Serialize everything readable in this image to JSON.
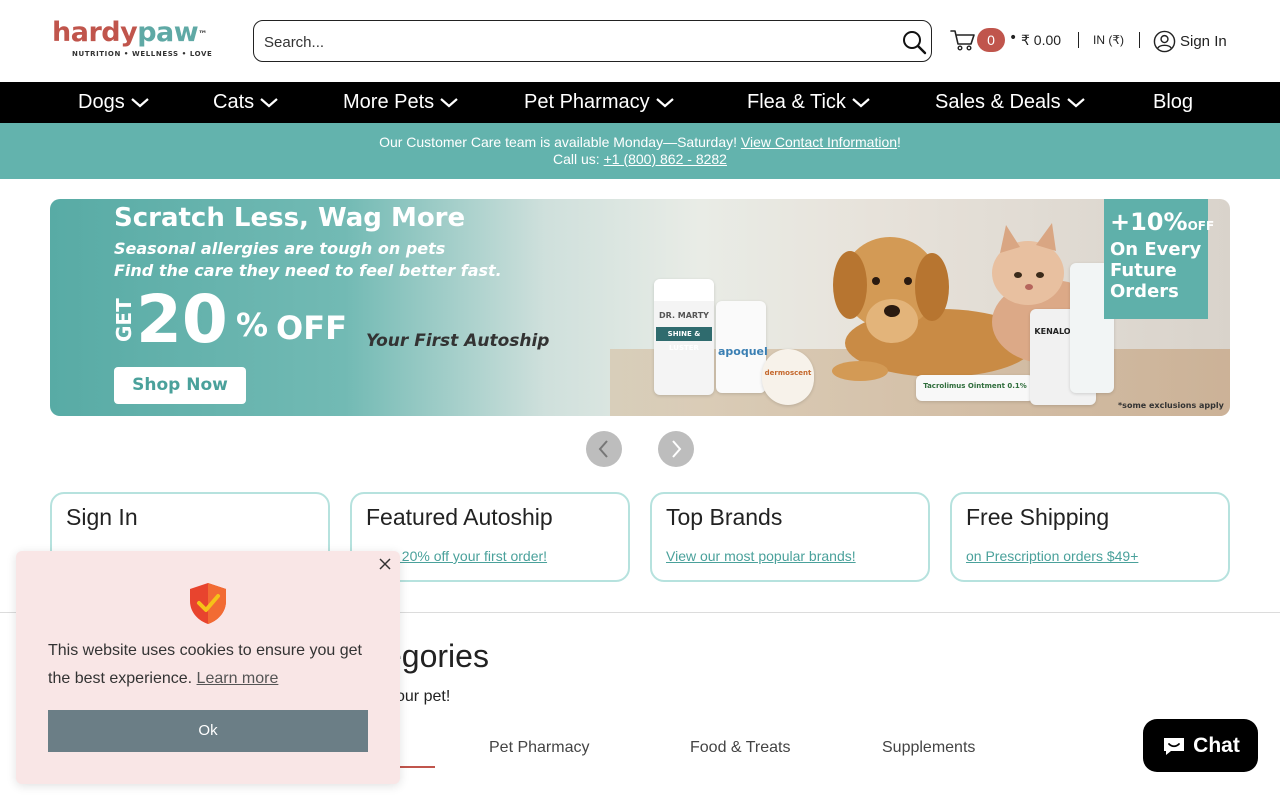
{
  "brand": {
    "logo_part1": "hardy",
    "logo_part2": "paw",
    "trademark": "™",
    "tagline": "NUTRITION  •  WELLNESS  •  LOVE"
  },
  "search": {
    "placeholder": "Search..."
  },
  "cart": {
    "count": "0",
    "separator": "•",
    "total": "₹ 0.00"
  },
  "locale": "IN (₹)",
  "account": {
    "signin_label": "Sign In"
  },
  "nav": {
    "items": [
      {
        "label": "Dogs",
        "has_dropdown": true
      },
      {
        "label": "Cats",
        "has_dropdown": true
      },
      {
        "label": "More Pets",
        "has_dropdown": true
      },
      {
        "label": "Pet Pharmacy",
        "has_dropdown": true
      },
      {
        "label": "Flea & Tick",
        "has_dropdown": true
      },
      {
        "label": "Sales & Deals",
        "has_dropdown": true
      },
      {
        "label": "Blog",
        "has_dropdown": false
      }
    ]
  },
  "info_bar": {
    "line1_text": "Our Customer Care team is available Monday—Saturday! ",
    "line1_link": "View Contact Information",
    "line1_end": "!",
    "line2_text": "Call us: ",
    "phone": "+1 (800) 862 - 8282"
  },
  "banner": {
    "headline": "Scratch Less, Wag More",
    "sub1": "Seasonal allergies are tough on pets",
    "sub2": "Find the care they need to feel better fast.",
    "get": "GET",
    "big_number": "20",
    "percent": "%",
    "off": "OFF",
    "autoship": "Your First Autoship",
    "cta": "Shop Now",
    "right_top": "+10%",
    "right_off": "OFF",
    "right_l1": "On Every",
    "right_l2": "Future",
    "right_l3": "Orders",
    "exclusions": "*some exclusions apply",
    "products": {
      "p1": "SHINE & LUSTER",
      "p1_brand": "DR. MARTY",
      "p2": "apoquel",
      "p3": "dermoscent",
      "p4": "Tacrolimus Ointment 0.1%",
      "p5": "KENALOG-10"
    }
  },
  "slider": {
    "prev_icon": "chevron-left-icon",
    "next_icon": "chevron-right-icon"
  },
  "features": [
    {
      "title": "Sign In",
      "link": ""
    },
    {
      "title": "Featured Autoship",
      "link": "Save 20% off your first order!"
    },
    {
      "title": "Top Brands",
      "link": "View our most popular brands!"
    },
    {
      "title": "Free Shipping",
      "link": "on Prescription orders $49+"
    }
  ],
  "categories": {
    "title_visible": "egories",
    "subtitle_visible": "our pet!",
    "tabs": [
      "Pet Pharmacy",
      "Food & Treats",
      "Supplements"
    ]
  },
  "cookie": {
    "message": "This website uses cookies to ensure you get the best experience.",
    "learn_more": "Learn more",
    "ok": "Ok"
  },
  "chat": {
    "label": "Chat"
  },
  "colors": {
    "brand_red": "#c0554c",
    "brand_teal": "#5fa9a5",
    "info_bar": "#63b3ad",
    "nav_bg": "#000000",
    "cookie_bg": "#f9e6e6",
    "cookie_button": "#6b7e86"
  }
}
